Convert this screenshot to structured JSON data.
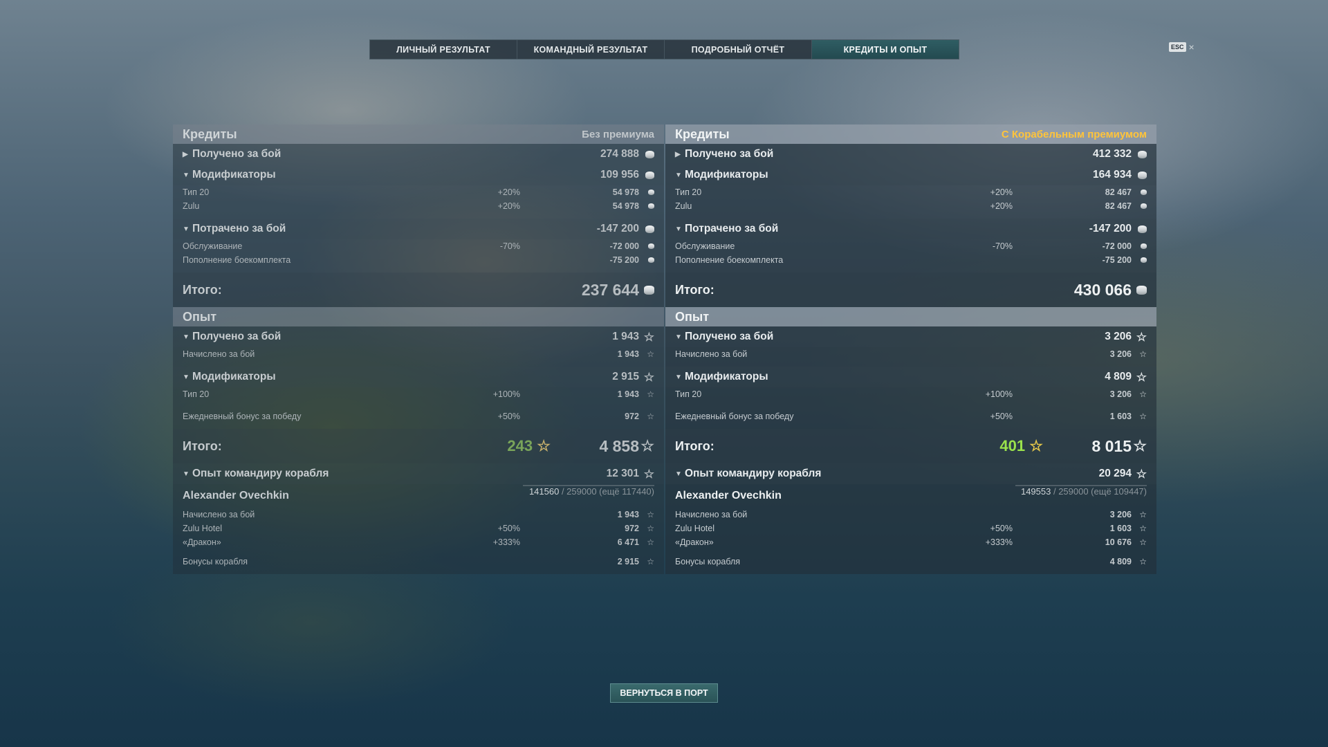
{
  "tabs": [
    "ЛИЧНЫЙ РЕЗУЛЬТАТ",
    "КОМАНДНЫЙ РЕЗУЛЬТАТ",
    "ПОДРОБНЫЙ ОТЧЁТ",
    "КРЕДИТЫ И ОПЫТ"
  ],
  "active_tab": "КРЕДИТЫ И ОПЫТ",
  "esc_label": "ESC",
  "close_glyph": "×",
  "back_button": "ВЕРНУТЬСЯ В ПОРТ",
  "colors": {
    "premium": "#ffc43a",
    "free_xp": "#9be24c",
    "progress": "#3fd0b8"
  },
  "left": {
    "credits_title": "Кредиты",
    "credits_mode": "Без премиума",
    "earned_label": "Получено за бой",
    "earned": "274 888",
    "mods_label": "Модификаторы",
    "mods": "109 956",
    "mod1_label": "Тип 20",
    "mod1_pct": "+20%",
    "mod1": "54 978",
    "mod2_label": "Zulu",
    "mod2_pct": "+20%",
    "mod2": "54 978",
    "spent_label": "Потрачено за бой",
    "spent": "-147 200",
    "svc_label": "Обслуживание",
    "svc_pct": "-70%",
    "svc": "-72 000",
    "ammo_label": "Пополнение боекомплекта",
    "ammo": "-75 200",
    "total_label": "Итого:",
    "credits_total": "237 644",
    "xp_title": "Опыт",
    "xp_earned_label": "Получено за бой",
    "xp_earned": "1 943",
    "xp_acc_label": "Начислено за бой",
    "xp_acc": "1 943",
    "xp_mods_label": "Модификаторы",
    "xp_mods": "2 915",
    "xp_mod1_label": "Тип 20",
    "xp_mod1_pct": "+100%",
    "xp_mod1": "1 943",
    "xp_mod2_label": "Ежедневный бонус за победу",
    "xp_mod2_pct": "+50%",
    "xp_mod2": "972",
    "xp_total_label": "Итого:",
    "free_xp": "243",
    "xp_total": "4 858",
    "cmdr_xp_label": "Опыт командиру корабля",
    "cmdr_xp": "12 301",
    "cmdr_name": "Alexander Ovechkin",
    "cmdr_progress_cur": "141560",
    "cmdr_progress_rest": " / 259000 (ещё 117440)",
    "cmdr_progress_fraction": 0.5466,
    "c1_label": "Начислено за бой",
    "c1": "1 943",
    "c2_label": "Zulu Hotel",
    "c2_pct": "+50%",
    "c2": "972",
    "c3_label": "«Дракон»",
    "c3_pct": "+333%",
    "c3": "6 471",
    "c4_label": "Бонусы корабля",
    "c4": "2 915"
  },
  "right": {
    "credits_title": "Кредиты",
    "credits_mode": "С Корабельным премиумом",
    "earned_label": "Получено за бой",
    "earned": "412 332",
    "mods_label": "Модификаторы",
    "mods": "164 934",
    "mod1_label": "Тип 20",
    "mod1_pct": "+20%",
    "mod1": "82 467",
    "mod2_label": "Zulu",
    "mod2_pct": "+20%",
    "mod2": "82 467",
    "spent_label": "Потрачено за бой",
    "spent": "-147 200",
    "svc_label": "Обслуживание",
    "svc_pct": "-70%",
    "svc": "-72 000",
    "ammo_label": "Пополнение боекомплекта",
    "ammo": "-75 200",
    "total_label": "Итого:",
    "credits_total": "430 066",
    "xp_title": "Опыт",
    "xp_earned_label": "Получено за бой",
    "xp_earned": "3 206",
    "xp_acc_label": "Начислено за бой",
    "xp_acc": "3 206",
    "xp_mods_label": "Модификаторы",
    "xp_mods": "4 809",
    "xp_mod1_label": "Тип 20",
    "xp_mod1_pct": "+100%",
    "xp_mod1": "3 206",
    "xp_mod2_label": "Ежедневный бонус за победу",
    "xp_mod2_pct": "+50%",
    "xp_mod2": "1 603",
    "xp_total_label": "Итого:",
    "free_xp": "401",
    "xp_total": "8 015",
    "cmdr_xp_label": "Опыт командиру корабля",
    "cmdr_xp": "20 294",
    "cmdr_name": "Alexander Ovechkin",
    "cmdr_progress_cur": "149553",
    "cmdr_progress_rest": " / 259000 (ещё 109447)",
    "cmdr_progress_fraction": 0.5774,
    "c1_label": "Начислено за бой",
    "c1": "3 206",
    "c2_label": "Zulu Hotel",
    "c2_pct": "+50%",
    "c2": "1 603",
    "c3_label": "«Дракон»",
    "c3_pct": "+333%",
    "c3": "10 676",
    "c4_label": "Бонусы корабля",
    "c4": "4 809"
  }
}
